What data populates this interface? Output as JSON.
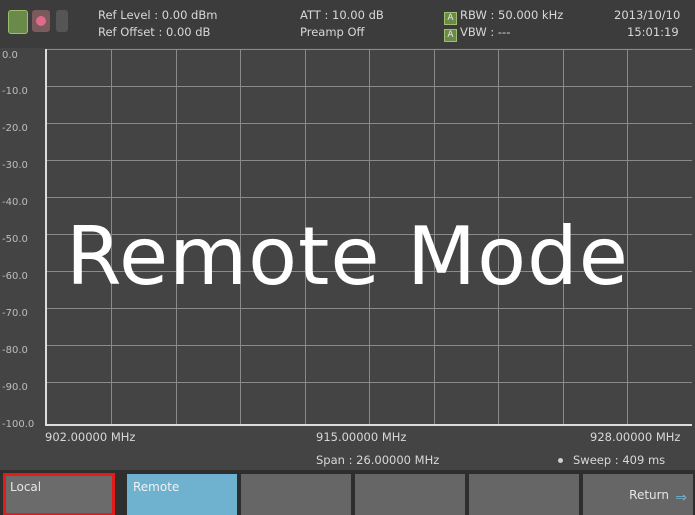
{
  "header": {
    "ref_level": "Ref Level : 0.00 dBm",
    "ref_offset": "Ref Offset : 0.00 dB",
    "att": "ATT : 10.00 dB",
    "preamp": "Preamp Off",
    "rbw_badge": "A",
    "rbw": "RBW : 50.000 kHz",
    "vbw_badge": "A",
    "vbw": "VBW : ---",
    "date": "2013/10/10",
    "time": "15:01:19"
  },
  "y_axis_labels": [
    "0.0",
    "-10.0",
    "-20.0",
    "-30.0",
    "-40.0",
    "-50.0",
    "-60.0",
    "-70.0",
    "-80.0",
    "-90.0",
    "-100.0"
  ],
  "overlay_text": "Remote Mode",
  "freq": {
    "start": "902.00000 MHz",
    "center": "915.00000 MHz",
    "stop": "928.00000 MHz",
    "span": "Span : 26.00000 MHz",
    "sweep": "Sweep : 409 ms"
  },
  "softkeys": {
    "local": "Local",
    "remote": "Remote",
    "return": "Return"
  },
  "colors": {
    "active_softkey": "#6fb2d0",
    "highlight_box": "#e21b1b"
  }
}
